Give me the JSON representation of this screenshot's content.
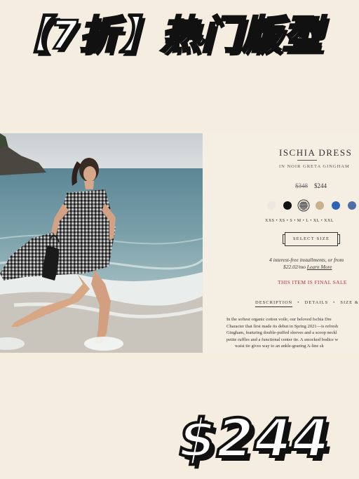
{
  "banner": {
    "headline": "【7折】热门版型"
  },
  "product": {
    "title": "ISCHIA DRESS",
    "subtitle": "IN NOIR GRETA GINGHAM",
    "original_price": "$348",
    "sale_price": "$244",
    "swatches": [
      "#ece8e1",
      "#111111",
      "#5d5d5d",
      "#c9b08c",
      "#2d63b7",
      "#5170a8"
    ],
    "sizes": "XXS  •  XS  •  S  •  M  •  L  •  XL  •  XXL",
    "select_size_label": "SELECT SIZE",
    "installments_line1": "4 interest-free installments, or from",
    "installments_amount": "$22.02/mo",
    "learn_more": "Learn More",
    "final_sale": "THIS ITEM IS FINAL SALE",
    "tabs": [
      "DESCRIPTION",
      "DETAILS",
      "SIZE &"
    ],
    "description_lines": [
      "In the softest organic cotton voile, our beloved Ischia Dre",
      "Character that first made its debut in Spring 2021—is refresh",
      "Gingham, featuring double-puffed sleeves and a scoop neckl",
      "petite ruffles and a functional center tie. A smocked bodice w",
      "waist tie gives way to an ankle-grazing A-line sk"
    ]
  },
  "footer": {
    "big_price": "$244"
  }
}
